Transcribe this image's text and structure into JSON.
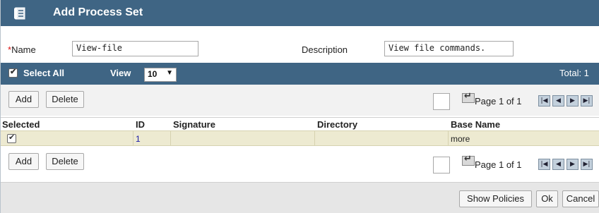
{
  "title": "Add Process Set",
  "form": {
    "name_required_mark": "*",
    "name_label": "Name",
    "name_value": "View-file",
    "description_label": "Description",
    "description_value": "View file commands."
  },
  "viewbar": {
    "select_all_label": "Select All",
    "view_label": "View",
    "view_value": "10",
    "total_label": "Total: 1"
  },
  "toolbar": {
    "add_label": "Add",
    "delete_label": "Delete",
    "page_label": "Page 1 of 1"
  },
  "table": {
    "headers": [
      "Selected",
      "ID",
      "Signature",
      "Directory",
      "Base Name"
    ],
    "rows": [
      {
        "selected": true,
        "id": "1",
        "signature": "",
        "directory": "",
        "base_name": "more"
      }
    ]
  },
  "footer": {
    "show_policies_label": "Show Policies",
    "ok_label": "Ok",
    "cancel_label": "Cancel"
  },
  "colors": {
    "header_bg": "#3f6584",
    "row_bg": "#edead1",
    "id_link": "#1a1aa6"
  }
}
